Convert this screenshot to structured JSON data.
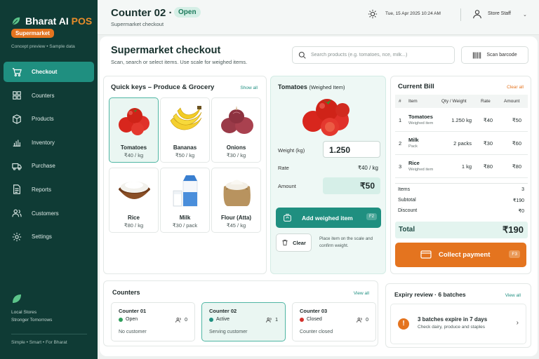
{
  "brand": {
    "name_a": "Bharat AI ",
    "name_b": "POS",
    "badge": "Supermarket",
    "concept": "Concept preview  •  Sample data"
  },
  "nav": [
    {
      "label": "Checkout",
      "icon": "cart-icon",
      "active": true
    },
    {
      "label": "Counters",
      "icon": "grid-icon"
    },
    {
      "label": "Products",
      "icon": "box-icon"
    },
    {
      "label": "Inventory",
      "icon": "bar-chart-icon"
    },
    {
      "label": "Purchase",
      "icon": "truck-icon"
    },
    {
      "label": "Reports",
      "icon": "document-icon"
    },
    {
      "label": "Customers",
      "icon": "users-icon"
    },
    {
      "label": "Settings",
      "icon": "gear-icon"
    }
  ],
  "sidebar_footer": {
    "line1": "Local Stores",
    "line2": "Stronger Tomorrows",
    "tagline": "Simple  •  Smart  •  For Bharat"
  },
  "header": {
    "counter_title": "Counter 02 ·",
    "status": "Open",
    "subtitle": "Supermarket checkout",
    "datetime": "Tue, 15 Apr 2025    10:24 AM",
    "user": "Store Staff"
  },
  "page": {
    "title": "Supermarket checkout",
    "subtitle": "Scan, search or select items. Use scale for weighed items."
  },
  "search": {
    "placeholder": "Search products (e.g. tomatoes, rice, milk...)",
    "value": ""
  },
  "scan_label": "Scan barcode",
  "quick_keys": {
    "title": "Quick keys – Produce & Grocery",
    "show_all": "Show all",
    "items": [
      {
        "name": "Tomatoes",
        "price": "₹40 / kg"
      },
      {
        "name": "Bananas",
        "price": "₹50 / kg"
      },
      {
        "name": "Onions",
        "price": "₹30 / kg"
      },
      {
        "name": "Rice",
        "price": "₹80 / kg"
      },
      {
        "name": "Milk",
        "price": "₹30 / pack"
      },
      {
        "name": "Flour (Atta)",
        "price": "₹45 / kg"
      }
    ]
  },
  "weighed": {
    "title": "Tomatoes",
    "title_note": "(Weighed Item)",
    "weight_label": "Weight (kg)",
    "weight_value": "1.250",
    "rate_label": "Rate",
    "rate_value": "₹40 / kg",
    "amount_label": "Amount",
    "amount_value": "₹50",
    "add_label": "Add weighed item",
    "add_key": "F2",
    "clear_label": "Clear",
    "hint": "Place item on the scale and confirm weight."
  },
  "bill": {
    "title": "Current Bill",
    "clear_all": "Clear all",
    "headers": [
      "#",
      "Item",
      "Qty / Weight",
      "Rate",
      "Amount"
    ],
    "rows": [
      {
        "no": "1",
        "name": "Tomatoes",
        "sub": "Weighed item",
        "qty": "1.250 kg",
        "rate": "₹40",
        "amount": "₹50"
      },
      {
        "no": "2",
        "name": "Milk",
        "sub": "Pack",
        "qty": "2 packs",
        "rate": "₹30",
        "amount": "₹60"
      },
      {
        "no": "3",
        "name": "Rice",
        "sub": "Weighed item",
        "qty": "1 kg",
        "rate": "₹80",
        "amount": "₹80"
      }
    ],
    "items_label": "Items",
    "items_value": "3",
    "subtotal_label": "Subtotal",
    "subtotal_value": "₹190",
    "discount_label": "Discount",
    "discount_value": "₹0",
    "total_label": "Total",
    "total_value": "₹190",
    "collect_label": "Collect payment",
    "collect_key": "F3"
  },
  "counters": {
    "title": "Counters",
    "view_all": "View all",
    "items": [
      {
        "name": "Counter 01",
        "status": "Open",
        "status_color": "#2f9e5b",
        "count": "0",
        "note": "No customer"
      },
      {
        "name": "Counter 02",
        "status": "Active",
        "status_color": "#1f8f80",
        "count": "1",
        "note": "Serving customer"
      },
      {
        "name": "Counter 03",
        "status": "Closed",
        "status_color": "#d3312c",
        "count": "0",
        "note": "Counter closed"
      }
    ]
  },
  "expiry": {
    "title": "Expiry review · 6 batches",
    "view_all": "View all",
    "headline": "3 batches expire in 7 days",
    "detail": "Check dairy, produce and staples"
  },
  "colors": {
    "accent": "#1f8f80",
    "sidebar": "#0f3b35",
    "orange": "#e4741f"
  }
}
